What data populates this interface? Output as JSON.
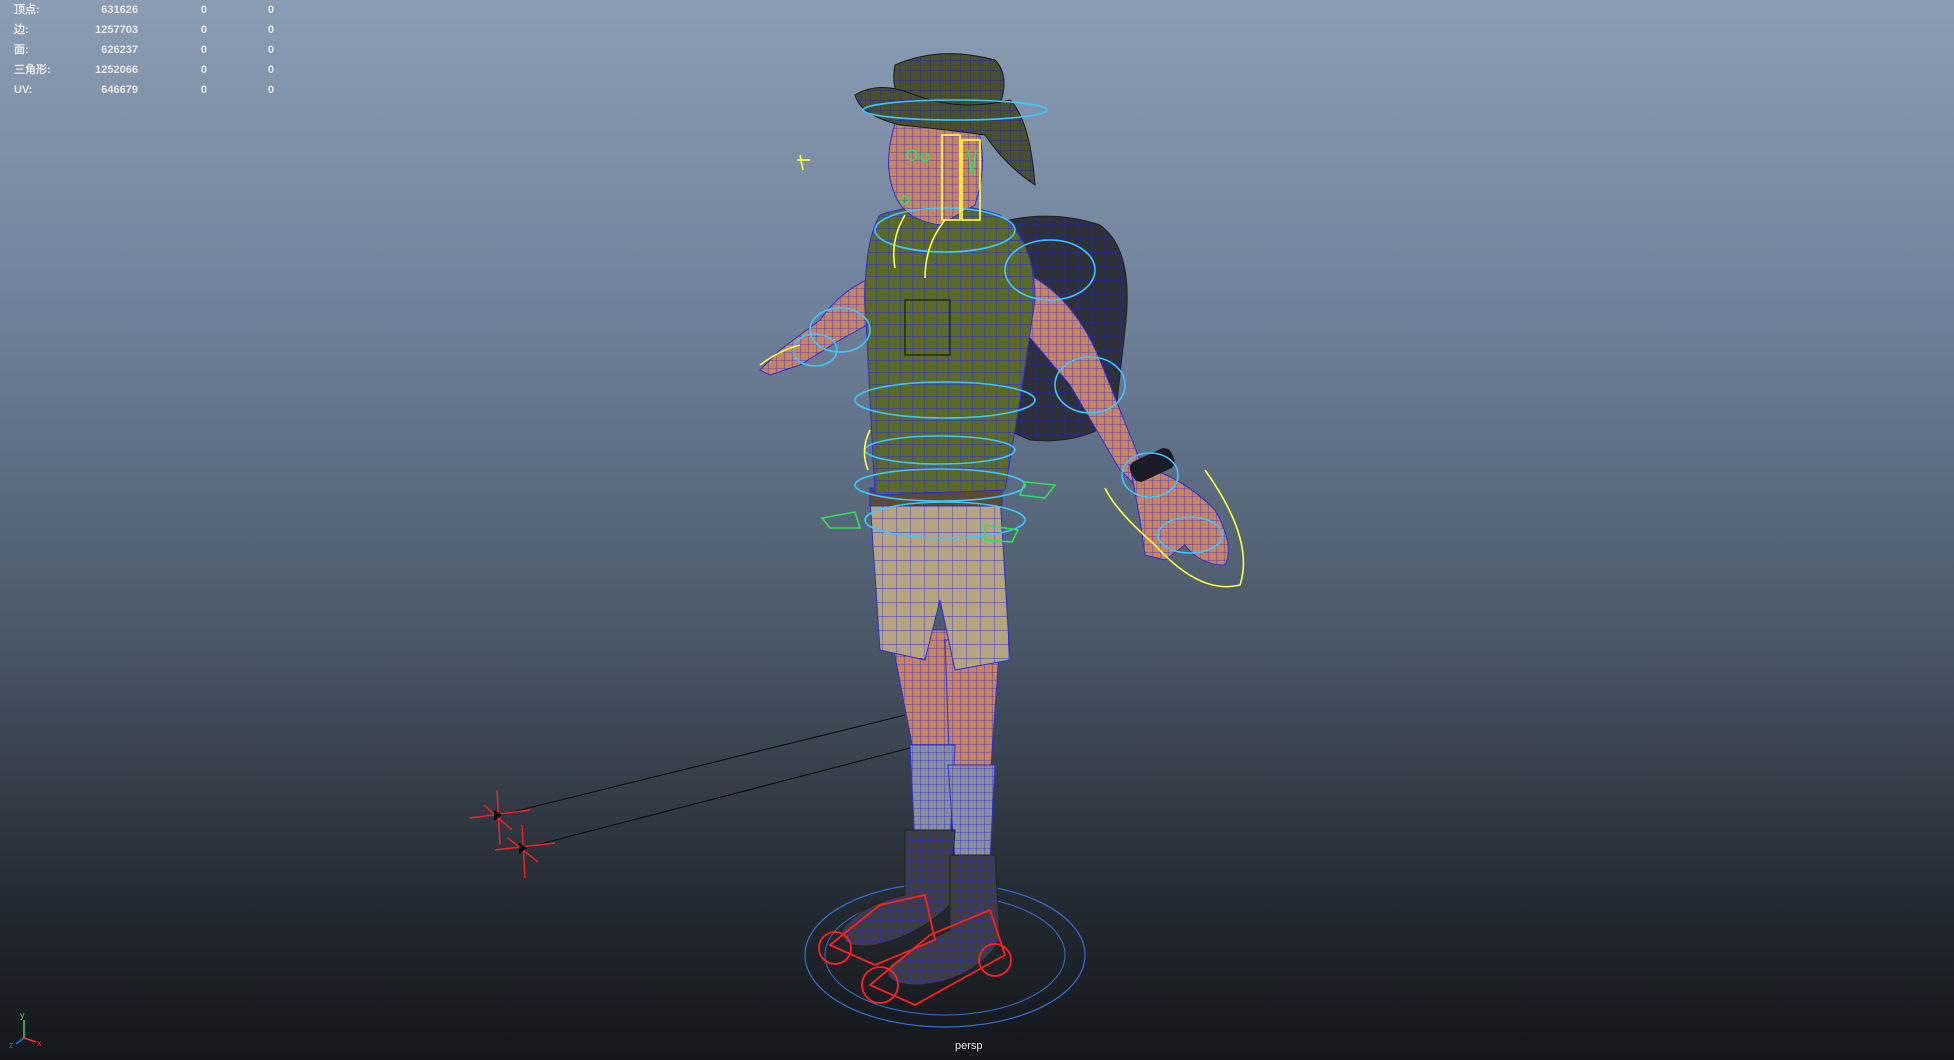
{
  "hud": {
    "rows": [
      {
        "label": "顶点:",
        "value": "631626",
        "sel": "0",
        "extra": "0"
      },
      {
        "label": "边:",
        "value": "1257703",
        "sel": "0",
        "extra": "0"
      },
      {
        "label": "面:",
        "value": "626237",
        "sel": "0",
        "extra": "0"
      },
      {
        "label": "三角形:",
        "value": "1252066",
        "sel": "0",
        "extra": "0"
      },
      {
        "label": "UV:",
        "value": "646679",
        "sel": "0",
        "extra": "0"
      }
    ]
  },
  "viewport": {
    "camera": "persp",
    "axis_labels": {
      "y": "y",
      "x": "x",
      "z": "z"
    }
  },
  "colors": {
    "bg_top": "#8b9db4",
    "bg_bottom": "#14171b",
    "wire_blue": "#2a2fd6",
    "ctrl_cyan": "#3fc6ff",
    "ctrl_yellow": "#ffff40",
    "ctrl_green": "#2fe05a",
    "ctrl_red": "#ff2020"
  }
}
